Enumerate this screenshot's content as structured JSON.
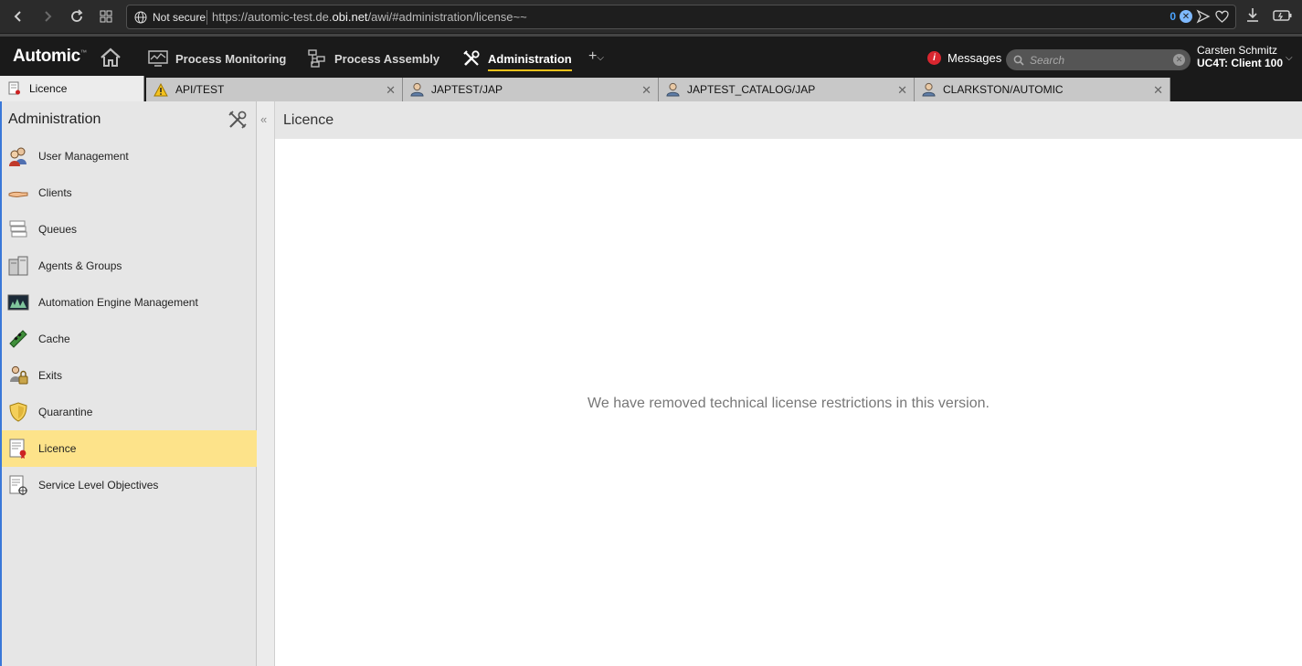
{
  "browser": {
    "security_label": "Not secure",
    "url_prefix": "https://automic-test.de.",
    "url_host": "obi.net",
    "url_path": "/awi/#administration/license~~",
    "badge_count": "0"
  },
  "app": {
    "logo": "Automic",
    "menu": [
      {
        "label": "Process Monitoring",
        "icon": "monitor-icon"
      },
      {
        "label": "Process Assembly",
        "icon": "assembly-icon"
      },
      {
        "label": "Administration",
        "icon": "tools-icon",
        "active": true
      }
    ],
    "messages_label": "Messages",
    "search_placeholder": "Search",
    "user_name": "Carsten Schmitz",
    "user_client": "UC4T: Client 100"
  },
  "tabs": [
    {
      "label": "Licence",
      "icon": "licence-icon",
      "active": true
    },
    {
      "label": "API/TEST",
      "icon": "warning-icon"
    },
    {
      "label": "JAPTEST/JAP",
      "icon": "user-icon"
    },
    {
      "label": "JAPTEST_CATALOG/JAP",
      "icon": "user-icon"
    },
    {
      "label": "CLARKSTON/AUTOMIC",
      "icon": "user-icon"
    }
  ],
  "sidebar": {
    "title": "Administration",
    "items": [
      {
        "label": "User Management",
        "icon": "users-icon"
      },
      {
        "label": "Clients",
        "icon": "hand-icon"
      },
      {
        "label": "Queues",
        "icon": "queues-icon"
      },
      {
        "label": "Agents & Groups",
        "icon": "agents-icon"
      },
      {
        "label": "Automation Engine Management",
        "icon": "engine-icon"
      },
      {
        "label": "Cache",
        "icon": "cache-icon"
      },
      {
        "label": "Exits",
        "icon": "exits-icon"
      },
      {
        "label": "Quarantine",
        "icon": "shield-icon"
      },
      {
        "label": "Licence",
        "icon": "licence-icon",
        "active": true
      },
      {
        "label": "Service Level Objectives",
        "icon": "slo-icon"
      }
    ]
  },
  "main": {
    "title": "Licence",
    "message": "We have removed technical license restrictions in this version."
  },
  "colors": {
    "accent": "#f3c21b",
    "selection": "#fde38a",
    "header_bg": "#1a1a1a",
    "alert": "#d9262f"
  }
}
